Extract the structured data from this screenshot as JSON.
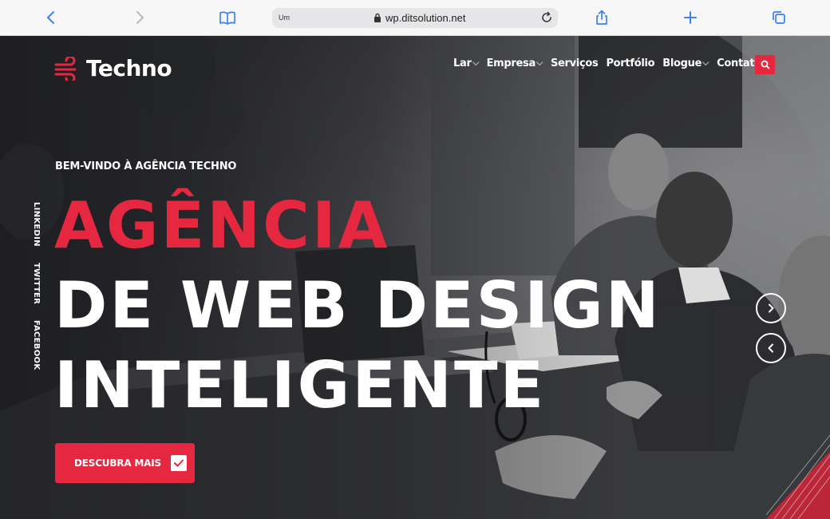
{
  "browser": {
    "tab_hint": "Um",
    "url": "wp.ditsolution.net",
    "icons": [
      "back-icon",
      "forward-icon",
      "book-icon",
      "lock-icon",
      "reload-icon",
      "share-icon",
      "plus-icon",
      "tabs-icon"
    ]
  },
  "site": {
    "logo_text": "Techno",
    "nav": [
      {
        "label": "Lar",
        "dropdown": true
      },
      {
        "label": "Empresa",
        "dropdown": true
      },
      {
        "label": "Serviços",
        "dropdown": false
      },
      {
        "label": "Portfólio",
        "dropdown": false
      },
      {
        "label": "Blogue",
        "dropdown": true
      },
      {
        "label": "Contato",
        "dropdown": false
      }
    ],
    "social": [
      "LINKEDIN",
      "TWITTER",
      "FACEBOOK"
    ]
  },
  "hero": {
    "welcome": "BEM-VINDO À AGÊNCIA TECHNO",
    "line1": "AGÊNCIA",
    "line2": "DE WEB DESIGN",
    "line3": "INTELIGENTE",
    "cta_label": "DESCUBRA MAIS"
  },
  "colors": {
    "accent": "#e5283f",
    "toolbar_icon": "#3b82f6"
  }
}
